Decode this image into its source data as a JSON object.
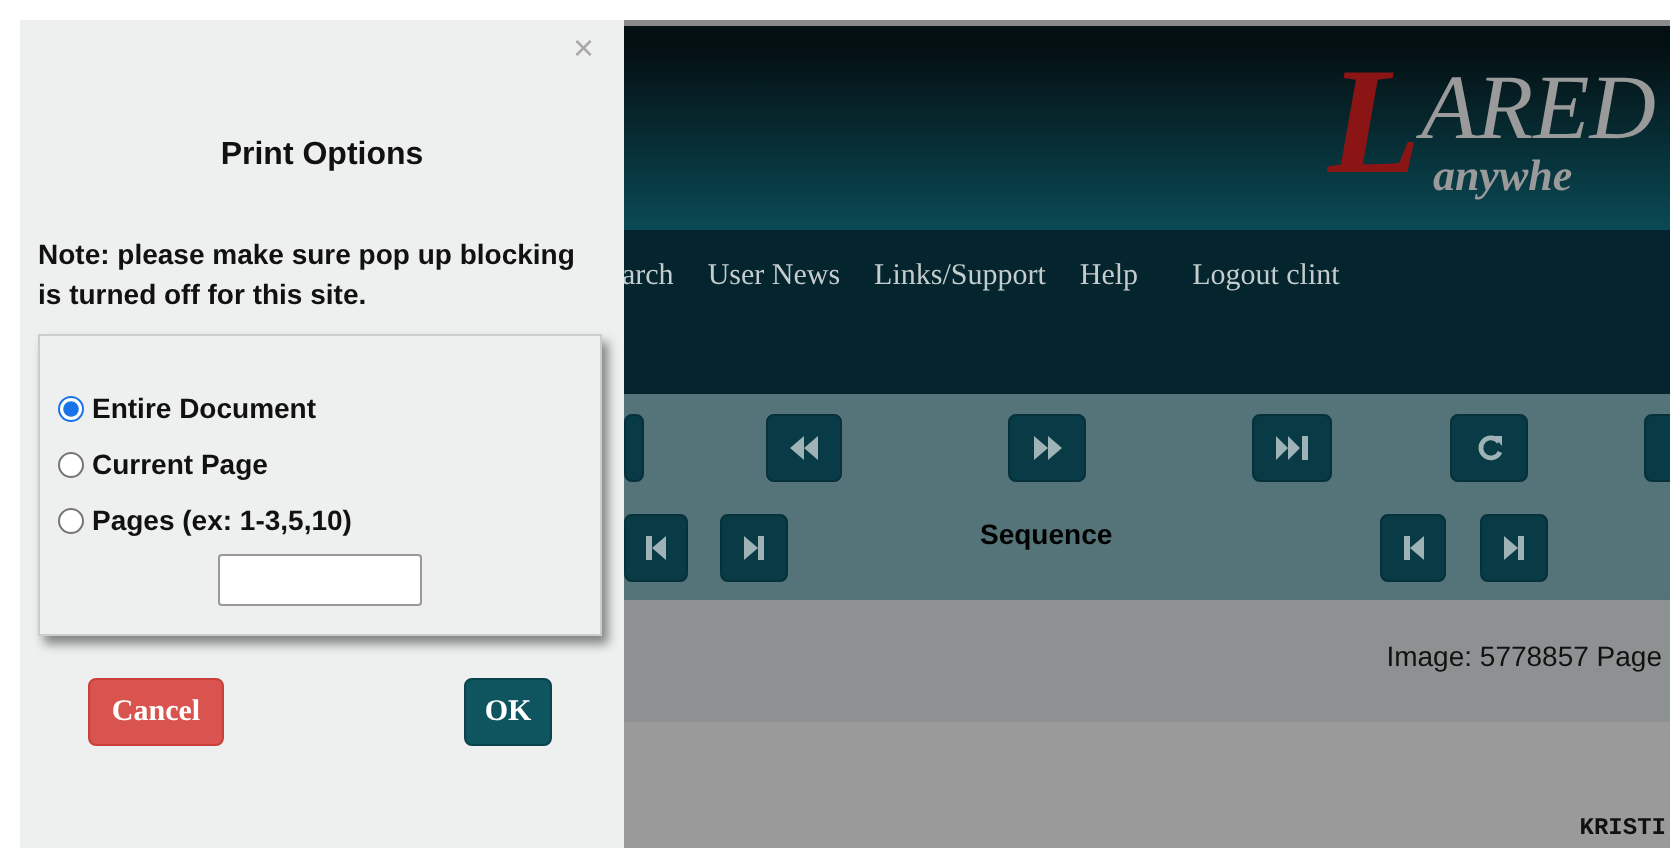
{
  "dialog": {
    "close": "×",
    "title": "Print Options",
    "note": "Note: please make sure pop up blocking is turned off for this site.",
    "options": [
      {
        "label": "Entire Document",
        "selected": true
      },
      {
        "label": "Current Page",
        "selected": false
      },
      {
        "label": "Pages (ex: 1-3,5,10)",
        "selected": false
      }
    ],
    "buttons": [
      {
        "kind": "cancel",
        "label": "Cancel"
      },
      {
        "kind": "ok",
        "label": "OK"
      }
    ]
  },
  "header": {
    "logo_initial": "L",
    "logo_rest": "ARED",
    "logo_tagline": "anywhe"
  },
  "nav": [
    "arch",
    "User News",
    "Links/Support",
    "Help",
    "Logout clint"
  ],
  "toolbar": {
    "row1": [
      {
        "kind": "partial"
      },
      {
        "kind": "rewind"
      },
      {
        "kind": "fast-forward"
      },
      {
        "kind": "last"
      },
      {
        "kind": "refresh"
      },
      {
        "kind": "partial"
      }
    ],
    "label": "Sequence",
    "row2": [
      {
        "kind": "first"
      },
      {
        "kind": "next"
      },
      {
        "kind": "first"
      },
      {
        "kind": "next"
      }
    ]
  },
  "info": "Image: 5778857 Page",
  "document_text": "KRISTI"
}
